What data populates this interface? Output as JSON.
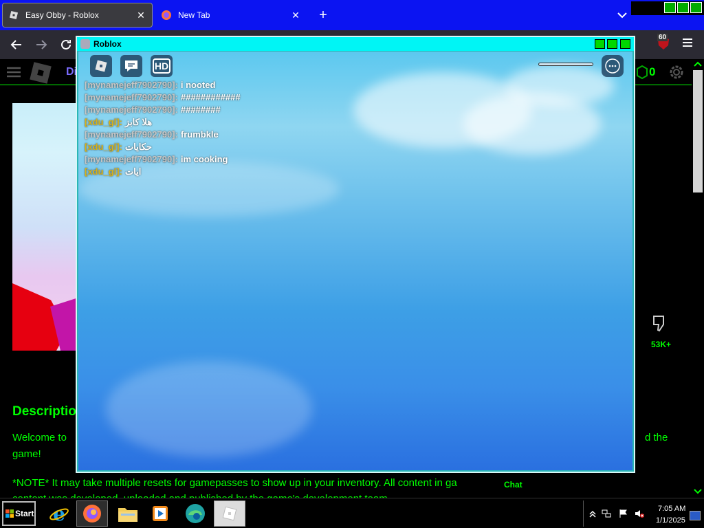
{
  "browser": {
    "tabs": [
      {
        "title": "Easy Obby - Roblox",
        "active": true,
        "icon": "roblox-favicon"
      },
      {
        "title": "New Tab",
        "active": false,
        "icon": "firefox-favicon"
      }
    ],
    "new_tab_glyph": "+",
    "close_glyph": "✕",
    "extension_badge": "60"
  },
  "page": {
    "nav_partial": "Di",
    "robux": "0",
    "dislikes": "53K+",
    "description_title": "Descriptio",
    "description_line1_start": "Welcome to",
    "description_line1_end": "d the",
    "description_line2": "game!",
    "description_note": "*NOTE* It may take multiple resets for gamepasses to show up in your inventory. All content in ga",
    "description_note2": "content was developed, uploaded and published by the game's development team.",
    "chat_label": "Chat"
  },
  "game_window": {
    "title": "Roblox",
    "hud_hd": "HD",
    "chat_messages": [
      {
        "user": "[mynamejeff7902790]:",
        "text": "i nooted",
        "user_color": "#c7c7c7"
      },
      {
        "user": "[mynamejeff7902790]:",
        "text": "############",
        "user_color": "#c7c7c7"
      },
      {
        "user": "[mynamejeff7902790]:",
        "text": "########",
        "user_color": "#c7c7c7"
      },
      {
        "user": "[xdu_gl]:",
        "text": "هلا كابز",
        "user_color": "#d9b318"
      },
      {
        "user": "[mynamejeff7902790]:",
        "text": "frumbkle",
        "user_color": "#c7c7c7"
      },
      {
        "user": "[xdu_gl]:",
        "text": "حكايات",
        "user_color": "#d9b318"
      },
      {
        "user": "[mynamejeff7902790]:",
        "text": "im cooking",
        "user_color": "#c7c7c7"
      },
      {
        "user": "[xdu_gl]:",
        "text": "ايات",
        "user_color": "#d9b318"
      }
    ]
  },
  "taskbar": {
    "start_label": "Start",
    "apps": [
      "internet-explorer-icon",
      "firefox-icon",
      "file-explorer-icon",
      "media-player-icon",
      "edge-icon",
      "roblox-icon"
    ],
    "time": "7:05 AM",
    "date": "1/1/2025"
  },
  "colors": {
    "tabstrip": "#0b14f2",
    "page_text": "#00ff00",
    "game_titlebar": "#00f5f5"
  }
}
